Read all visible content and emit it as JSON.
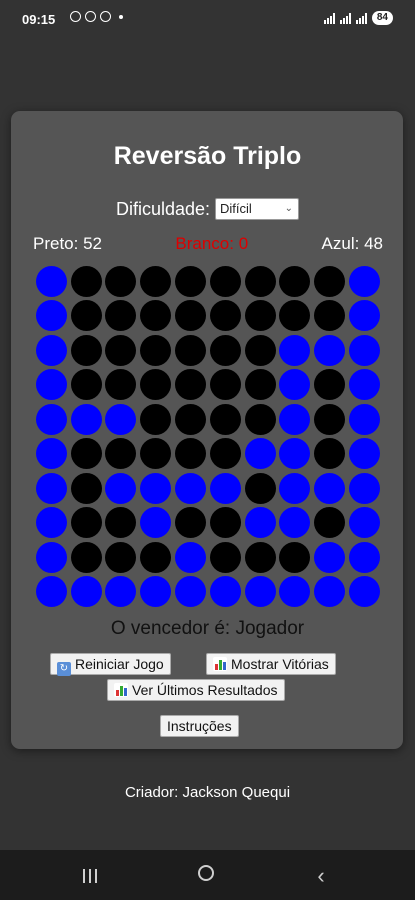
{
  "status_bar": {
    "time": "09:15",
    "battery": "84"
  },
  "game": {
    "title": "Reversão Triplo",
    "difficulty_label": "Dificuldade:",
    "difficulty_selected": "Difícil",
    "scores": {
      "black_label": "Preto: 52",
      "white_label": "Branco: 0",
      "blue_label": "Azul: 48"
    },
    "board": [
      "BKKKKKKKKB",
      "BKKKKKKKKB",
      "BKKKKKKBBB",
      "BKKKKKKBKB",
      "BBBKKKKBKB",
      "BKKKKKBBKB",
      "BKBBBBKBBB",
      "BKKBKKBBKB",
      "BKKKBKKKBB",
      "BBBBBBBBBB"
    ],
    "colors": {
      "B": "#0000ff",
      "K": "#000000",
      "W": "#ffffff"
    },
    "winner_text": "O vencedor é: Jogador",
    "buttons": {
      "restart": "Reiniciar Jogo",
      "show_wins": "Mostrar Vitórias",
      "last_results": "Ver Últimos Resultados",
      "instructions": "Instruções"
    }
  },
  "footer": {
    "creator": "Criador: Jackson Quequi"
  }
}
